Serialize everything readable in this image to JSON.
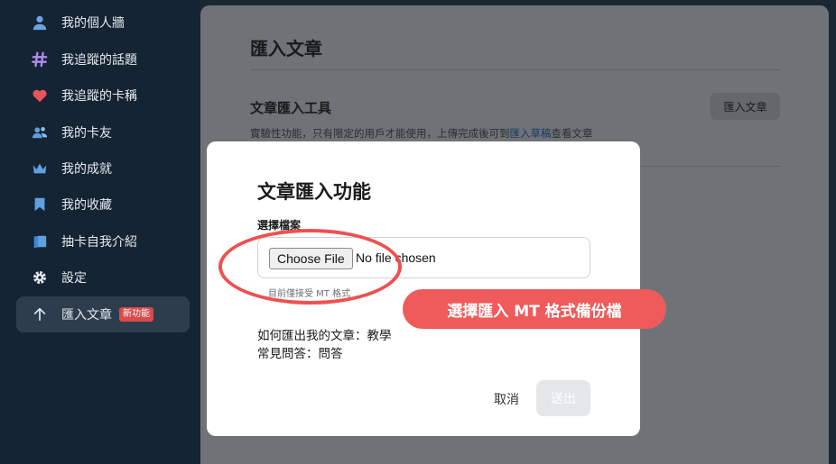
{
  "sidebar": {
    "items": [
      {
        "icon": "user-icon",
        "label": "我的個人牆"
      },
      {
        "icon": "hashtag-icon",
        "label": "我追蹤的話題"
      },
      {
        "icon": "heart-icon",
        "label": "我追蹤的卡稱"
      },
      {
        "icon": "friends-icon",
        "label": "我的卡友"
      },
      {
        "icon": "crown-icon",
        "label": "我的成就"
      },
      {
        "icon": "bookmark-icon",
        "label": "我的收藏"
      },
      {
        "icon": "card-icon",
        "label": "抽卡自我介紹"
      },
      {
        "icon": "gear-icon",
        "label": "設定"
      },
      {
        "icon": "arrow-up-icon",
        "label": "匯入文章",
        "badge": "新功能"
      }
    ]
  },
  "main": {
    "title": "匯入文章",
    "tool_title": "文章匯入工具",
    "tool_button": "匯入文章",
    "desc_before": "實驗性功能，只有限定的用戶才能使用，上傳完成後可到",
    "desc_link": "匯入草稿",
    "desc_after": "查看文章"
  },
  "modal": {
    "title": "文章匯入功能",
    "field_label": "選擇檔案",
    "choose_button": "Choose File",
    "file_status": "No file chosen",
    "hint": "目前僅接受 MT 格式",
    "help_export": "如何匯出我的文章：教學",
    "help_faq": "常見問答：問答",
    "cancel": "取消",
    "submit": "送出"
  },
  "annotation": {
    "callout": "選擇匯入 MT 格式備份檔"
  },
  "colors": {
    "sidebar_bg": "#152433",
    "active_bg": "#2d3d4d",
    "badge": "#d94a4a",
    "annotation": "#ef5b5b",
    "link": "#2a6fd4"
  }
}
